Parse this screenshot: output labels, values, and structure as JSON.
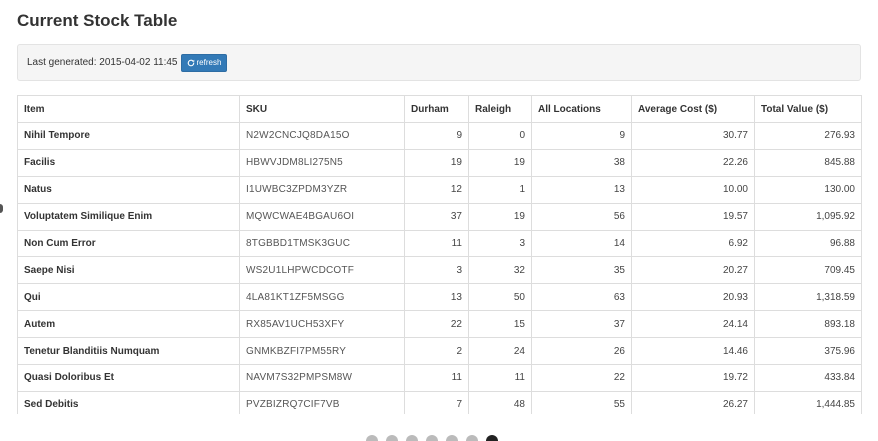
{
  "page": {
    "title": "Current Stock Table"
  },
  "info": {
    "last_generated_label": "Last generated:",
    "last_generated_value": "2015-04-02 11:45",
    "refresh_label": "refresh",
    "refresh_icon": "refresh-icon"
  },
  "table": {
    "headers": [
      "Item",
      "SKU",
      "Durham",
      "Raleigh",
      "All Locations",
      "Average Cost ($)",
      "Total Value ($)"
    ],
    "rows": [
      {
        "item": "Nihil Tempore",
        "sku": "N2W2CNCJQ8DA15O",
        "durham": "9",
        "raleigh": "0",
        "all": "9",
        "avg": "30.77",
        "total": "276.93"
      },
      {
        "item": "Facilis",
        "sku": "HBWVJDM8LI275N5",
        "durham": "19",
        "raleigh": "19",
        "all": "38",
        "avg": "22.26",
        "total": "845.88"
      },
      {
        "item": "Natus",
        "sku": "I1UWBC3ZPDM3YZR",
        "durham": "12",
        "raleigh": "1",
        "all": "13",
        "avg": "10.00",
        "total": "130.00"
      },
      {
        "item": "Voluptatem Similique Enim",
        "sku": "MQWCWAE4BGAU6OI",
        "durham": "37",
        "raleigh": "19",
        "all": "56",
        "avg": "19.57",
        "total": "1,095.92"
      },
      {
        "item": "Non Cum Error",
        "sku": "8TGBBD1TMSK3GUC",
        "durham": "11",
        "raleigh": "3",
        "all": "14",
        "avg": "6.92",
        "total": "96.88"
      },
      {
        "item": "Saepe Nisi",
        "sku": "WS2U1LHPWCDCOTF",
        "durham": "3",
        "raleigh": "32",
        "all": "35",
        "avg": "20.27",
        "total": "709.45"
      },
      {
        "item": "Qui",
        "sku": "4LA81KT1ZF5MSGG",
        "durham": "13",
        "raleigh": "50",
        "all": "63",
        "avg": "20.93",
        "total": "1,318.59"
      },
      {
        "item": "Autem",
        "sku": "RX85AV1UCH53XFY",
        "durham": "22",
        "raleigh": "15",
        "all": "37",
        "avg": "24.14",
        "total": "893.18"
      },
      {
        "item": "Tenetur Blanditiis Numquam",
        "sku": "GNMKBZFI7PM55RY",
        "durham": "2",
        "raleigh": "24",
        "all": "26",
        "avg": "14.46",
        "total": "375.96"
      },
      {
        "item": "Quasi Doloribus Et",
        "sku": "NAVM7S32PMPSM8W",
        "durham": "11",
        "raleigh": "11",
        "all": "22",
        "avg": "19.72",
        "total": "433.84"
      },
      {
        "item": "Sed Debitis",
        "sku": "PVZBIZRQ7CIF7VB",
        "durham": "7",
        "raleigh": "48",
        "all": "55",
        "avg": "26.27",
        "total": "1,444.85"
      }
    ]
  },
  "pagination": {
    "count": 7,
    "active": 7
  },
  "colors": {
    "primary_button": "#337ab7",
    "panel_bg": "#f5f5f5",
    "border": "#dddddd"
  }
}
